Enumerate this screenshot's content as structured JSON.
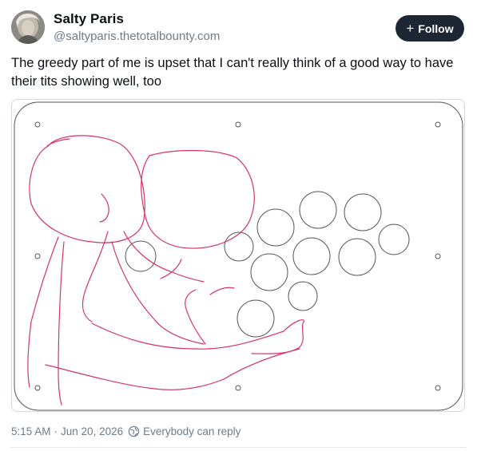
{
  "author": {
    "name": "Salty Paris",
    "handle": "@saltyparis.thetotalbounty.com",
    "avatar_icon": "profile-photo"
  },
  "follow_button": {
    "label": "Follow",
    "icon": "plus-icon"
  },
  "post": {
    "text": "The greedy part of me is upset that I can't really think of a good way to have their tits showing well, too",
    "image": {
      "description_icon": "sketch-image",
      "stroke_color": "#d6336c",
      "panel_outline_color": "#555555"
    }
  },
  "meta": {
    "time": "5:15 AM",
    "separator": "·",
    "date": "Jun 20, 2026",
    "reply_setting": "Everybody can reply",
    "reply_icon": "everybody-globe-icon"
  },
  "colors": {
    "follow_bg": "#1c2733",
    "muted_text": "#6f7b88",
    "body_text": "#0b0f14"
  }
}
